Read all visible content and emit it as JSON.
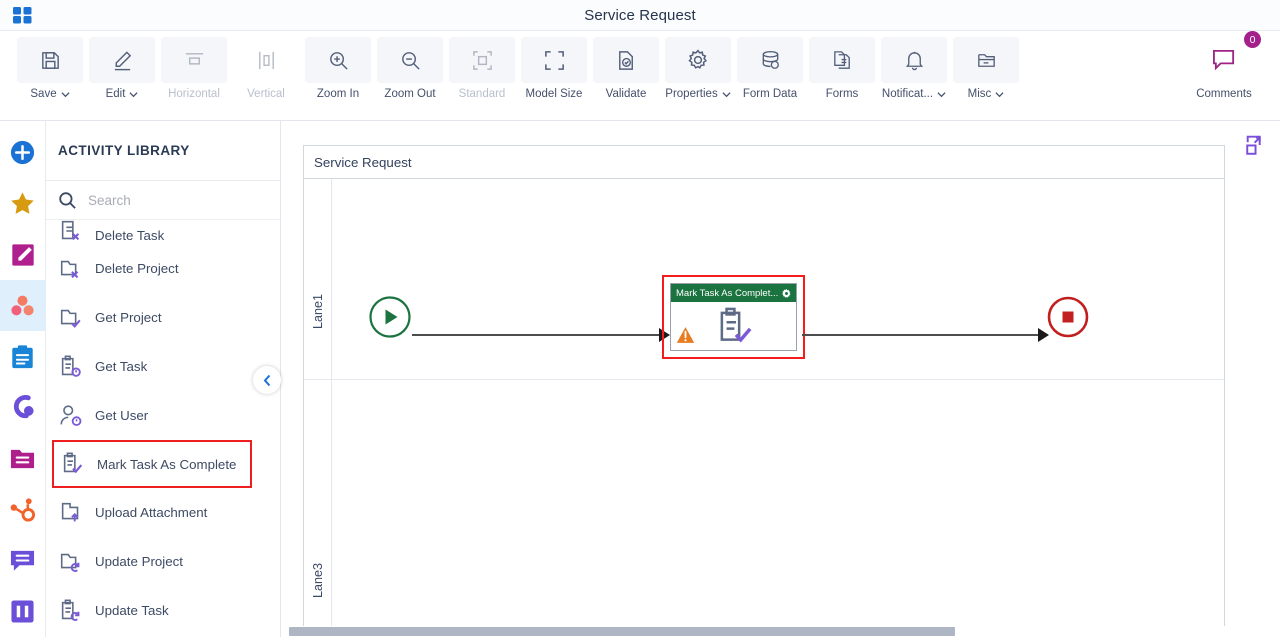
{
  "titlebar": {
    "app_icon": "app-grid-icon",
    "title": "Service Request"
  },
  "toolbar": {
    "items": [
      {
        "id": "save",
        "label": "Save",
        "icon": "save-icon",
        "caret": true,
        "disabled": false,
        "boxed": true
      },
      {
        "id": "edit",
        "label": "Edit",
        "icon": "edit-pencil-icon",
        "caret": true,
        "disabled": false,
        "boxed": true
      },
      {
        "id": "horizontal",
        "label": "Horizontal",
        "icon": "horizontal-align-icon",
        "caret": false,
        "disabled": true,
        "boxed": true
      },
      {
        "id": "vertical",
        "label": "Vertical",
        "icon": "vertical-align-icon",
        "caret": false,
        "disabled": true,
        "boxed": false
      },
      {
        "id": "zoom-in",
        "label": "Zoom In",
        "icon": "zoom-in-icon",
        "caret": false,
        "disabled": false,
        "boxed": true
      },
      {
        "id": "zoom-out",
        "label": "Zoom Out",
        "icon": "zoom-out-icon",
        "caret": false,
        "disabled": false,
        "boxed": true
      },
      {
        "id": "standard",
        "label": "Standard",
        "icon": "standard-size-icon",
        "caret": false,
        "disabled": true,
        "boxed": true
      },
      {
        "id": "model-size",
        "label": "Model Size",
        "icon": "model-size-icon",
        "caret": false,
        "disabled": false,
        "boxed": true
      },
      {
        "id": "validate",
        "label": "Validate",
        "icon": "validate-icon",
        "caret": false,
        "disabled": false,
        "boxed": true
      },
      {
        "id": "properties",
        "label": "Properties",
        "icon": "gear-icon",
        "caret": true,
        "disabled": false,
        "boxed": true
      },
      {
        "id": "form-data",
        "label": "Form Data",
        "icon": "database-icon",
        "caret": false,
        "disabled": false,
        "boxed": true
      },
      {
        "id": "forms",
        "label": "Forms",
        "icon": "forms-icon",
        "caret": false,
        "disabled": false,
        "boxed": true
      },
      {
        "id": "notifications",
        "label": "Notificat...",
        "icon": "bell-icon",
        "caret": true,
        "disabled": false,
        "boxed": true
      },
      {
        "id": "misc",
        "label": "Misc",
        "icon": "misc-folder-icon",
        "caret": true,
        "disabled": false,
        "boxed": true
      }
    ],
    "comments": {
      "label": "Comments",
      "icon": "comment-icon",
      "badge": "0",
      "badge_color": "#a4218c"
    }
  },
  "rail": {
    "items": [
      {
        "id": "add",
        "icon": "plus-circle-icon",
        "color": "#1a73d4",
        "active": false
      },
      {
        "id": "favorites",
        "icon": "star-icon",
        "color": "#d79b11",
        "active": false
      },
      {
        "id": "edit",
        "icon": "edit-square-icon",
        "color": "#b01f8e",
        "active": false
      },
      {
        "id": "activities",
        "icon": "three-circles-icon",
        "color": "#f0685a",
        "active": true
      },
      {
        "id": "tasks",
        "icon": "clipboard-icon",
        "color": "#1a85d6",
        "active": false
      },
      {
        "id": "asana",
        "icon": "asana-icon",
        "color": "#6c4fd8",
        "active": false
      },
      {
        "id": "files",
        "icon": "folder-icon",
        "color": "#ae1f8c",
        "active": false
      },
      {
        "id": "hubspot",
        "icon": "hubspot-icon",
        "color": "#f3622a",
        "active": false
      },
      {
        "id": "messages",
        "icon": "chat-icon",
        "color": "#6c4fd8",
        "active": false
      },
      {
        "id": "columns",
        "icon": "columns-icon",
        "color": "#6c4fd8",
        "active": false
      }
    ]
  },
  "library": {
    "title": "ACTIVITY LIBRARY",
    "search_placeholder": "Search",
    "search_value": "",
    "search_icon": "search-icon",
    "collapse_icon": "chevron-left-icon",
    "activities": [
      {
        "id": "delete-task",
        "label": "Delete Task",
        "icon": "delete-task-icon",
        "selected": false,
        "clipped": true
      },
      {
        "id": "delete-project",
        "label": "Delete Project",
        "icon": "delete-project-icon",
        "selected": false,
        "clipped": false
      },
      {
        "id": "get-project",
        "label": "Get Project",
        "icon": "get-project-icon",
        "selected": false,
        "clipped": false
      },
      {
        "id": "get-task",
        "label": "Get Task",
        "icon": "get-task-icon",
        "selected": false,
        "clipped": false
      },
      {
        "id": "get-user",
        "label": "Get User",
        "icon": "get-user-icon",
        "selected": false,
        "clipped": false
      },
      {
        "id": "mark-task-complete",
        "label": "Mark Task As Complete",
        "icon": "mark-task-complete-icon",
        "selected": true,
        "clipped": false
      },
      {
        "id": "upload-attachment",
        "label": "Upload Attachment",
        "icon": "upload-attachment-icon",
        "selected": false,
        "clipped": false
      },
      {
        "id": "update-project",
        "label": "Update Project",
        "icon": "update-project-icon",
        "selected": false,
        "clipped": false
      },
      {
        "id": "update-task",
        "label": "Update Task",
        "icon": "update-task-icon",
        "selected": false,
        "clipped": false
      }
    ]
  },
  "canvas": {
    "pool_title": "Service Request",
    "expand_icon": "expand-canvas-icon",
    "expand_icon_color": "#7b4ddb",
    "lanes": [
      {
        "id": "lane1",
        "label": "Lane1"
      },
      {
        "id": "lane3",
        "label": "Lane3"
      }
    ],
    "start_event": {
      "name": "start-event",
      "color": "#1b7340"
    },
    "end_event": {
      "name": "end-event",
      "color": "#c22020"
    },
    "task_node": {
      "title": "Mark Task As Complet...",
      "header_color": "#1b7340",
      "selection_color": "#f41c1c",
      "gear_icon": "gear-icon",
      "body_icon": "mark-task-complete-icon",
      "warning_icon": "warning-triangle-icon"
    }
  }
}
